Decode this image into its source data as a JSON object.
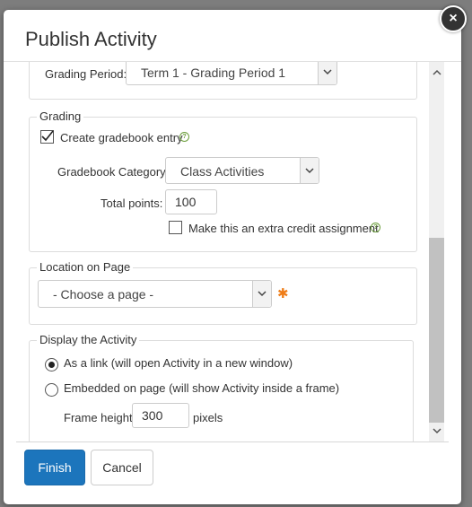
{
  "dialog": {
    "title": "Publish Activity",
    "close_symbol": "×"
  },
  "grading_period": {
    "label": "Grading Period:",
    "value": "Term 1 - Grading Period 1"
  },
  "grading": {
    "legend": "Grading",
    "create_entry_label": "Create gradebook entry",
    "create_entry_checked": true,
    "category_label": "Gradebook Category:",
    "category_value": "Class Activities",
    "total_points_label": "Total points:",
    "total_points_value": "100",
    "extra_credit_label": "Make this an extra credit assignment",
    "extra_credit_checked": false
  },
  "location": {
    "legend": "Location on Page",
    "select_value": "- Choose a page -",
    "required_marker": "✱"
  },
  "display": {
    "legend": "Display the Activity",
    "option_link_label": "As a link (will open Activity in a new window)",
    "option_embedded_label": "Embedded on page (will show Activity inside a frame)",
    "selected": "link",
    "frame_height_label": "Frame height",
    "frame_height_value": "300",
    "frame_height_unit": "pixels"
  },
  "footer": {
    "finish_label": "Finish",
    "cancel_label": "Cancel"
  },
  "icons": {
    "help": "help-circle-icon",
    "dropdown": "chevron-down-icon",
    "scroll_up": "chevron-up-icon",
    "scroll_down": "chevron-down-icon"
  },
  "colors": {
    "primary": "#1c75bc",
    "help_icon": "#6a9d3a",
    "required": "#ef7d18"
  }
}
